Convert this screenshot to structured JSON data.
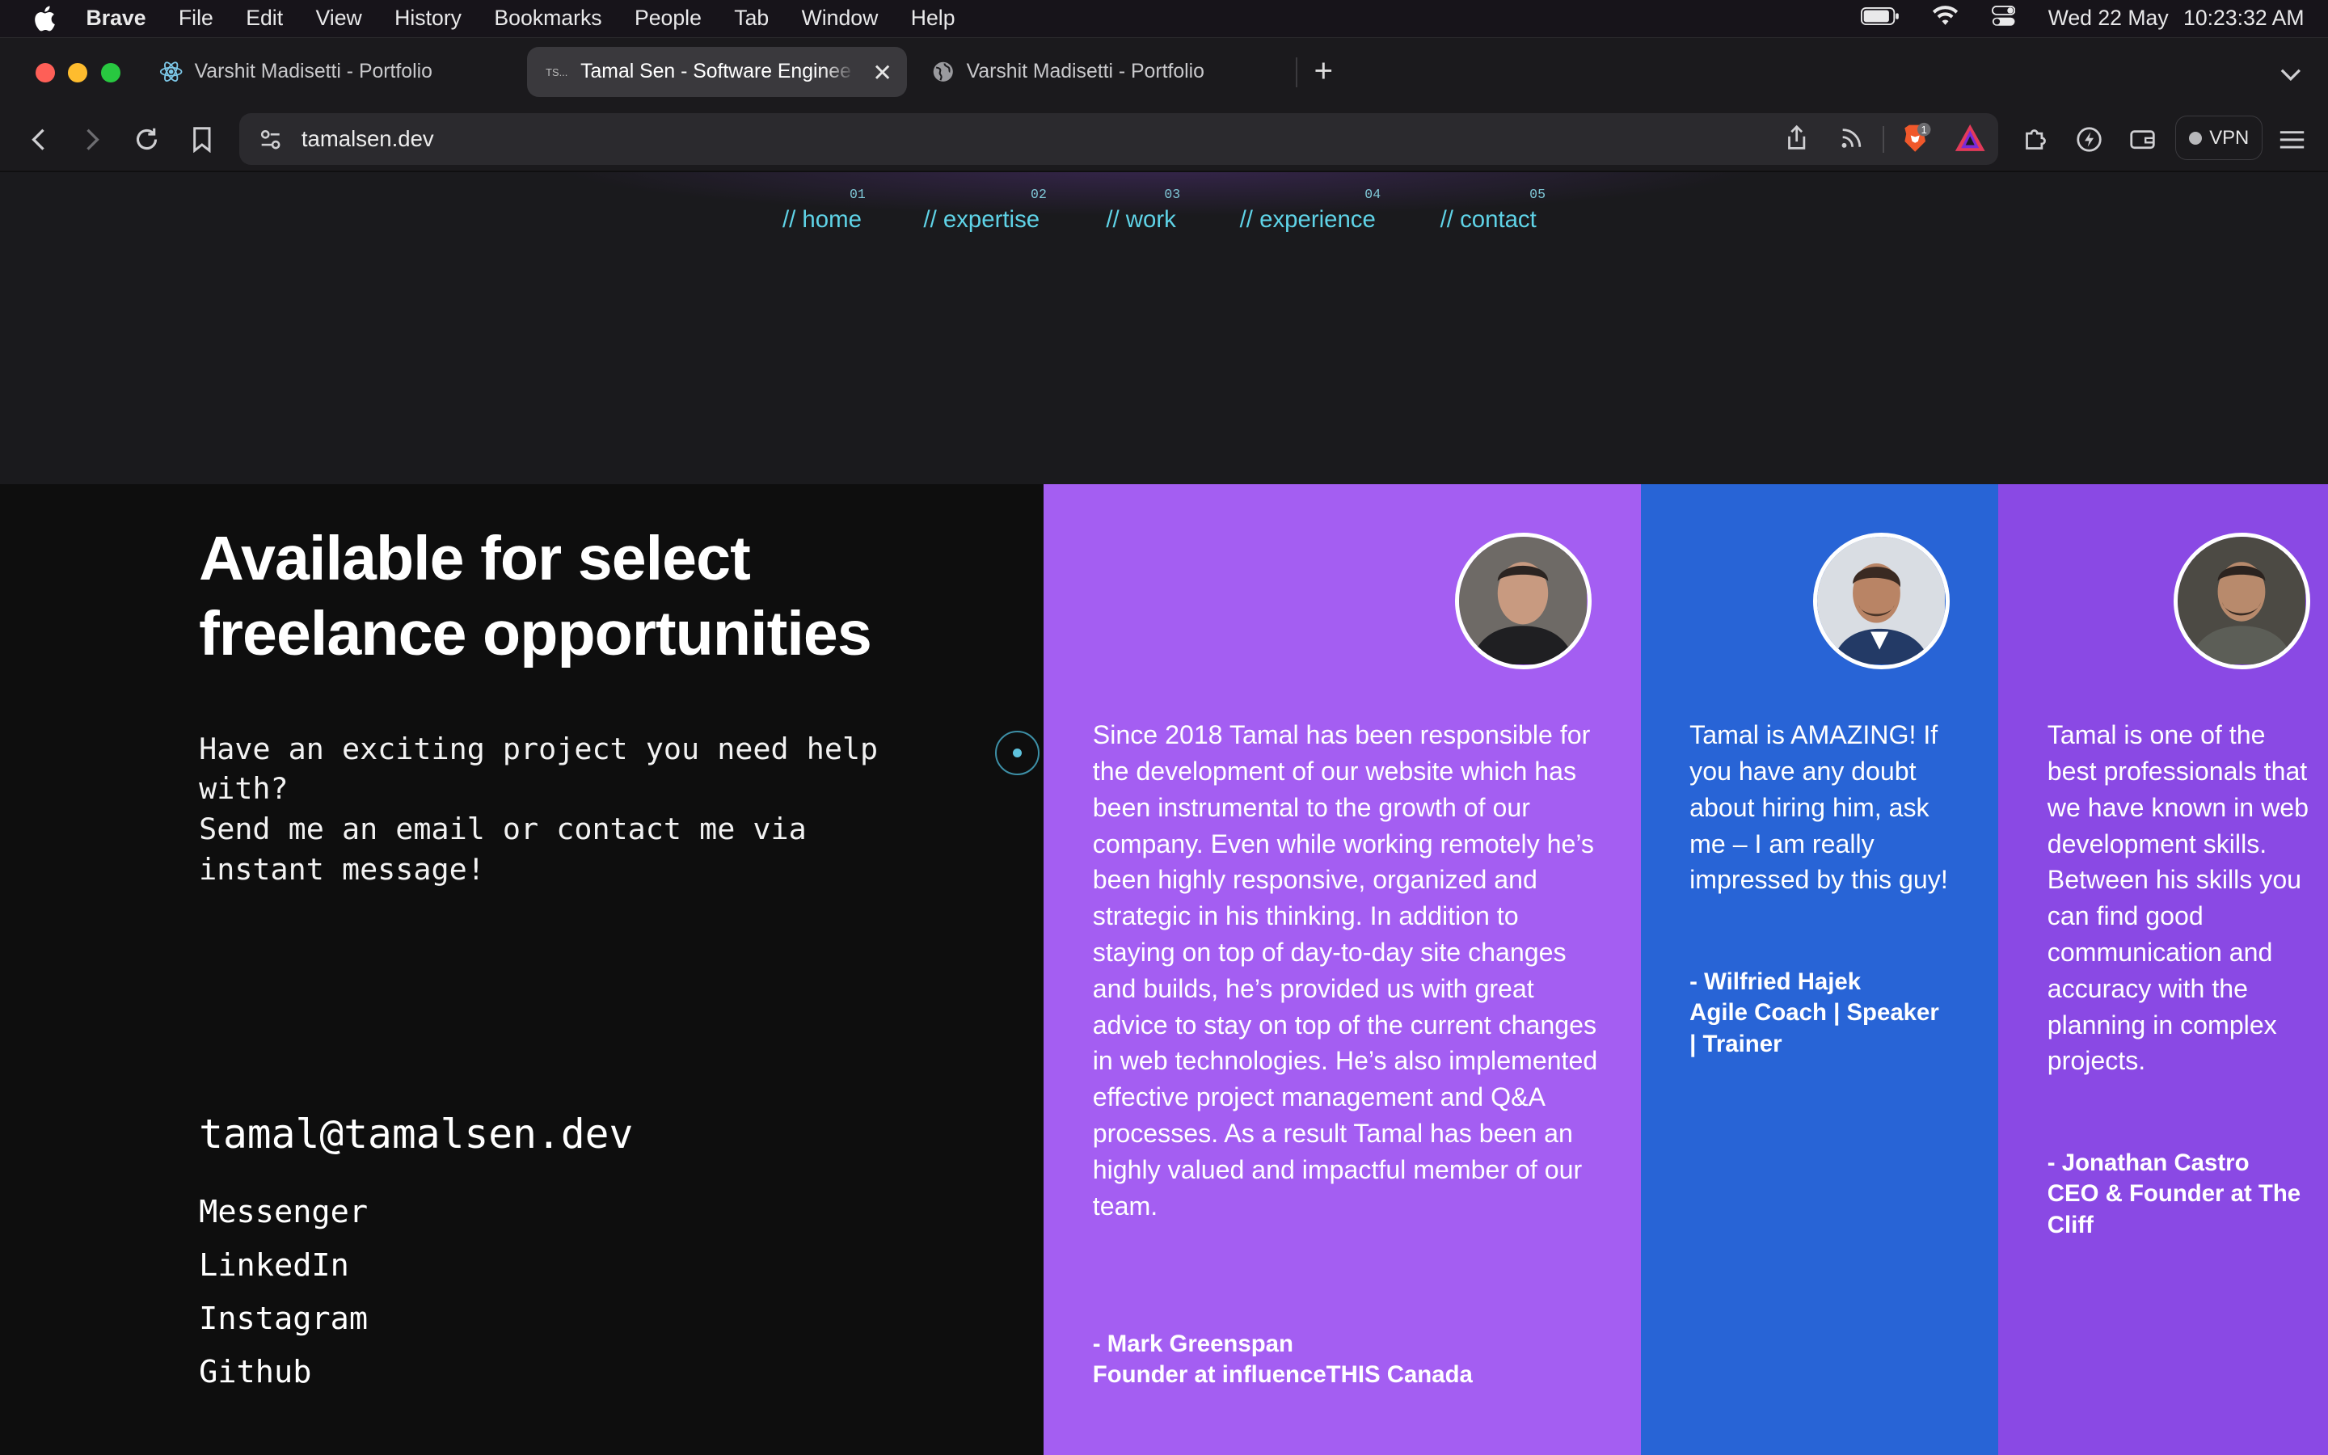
{
  "menubar": {
    "app": "Brave",
    "items": [
      "File",
      "Edit",
      "View",
      "History",
      "Bookmarks",
      "People",
      "Tab",
      "Window",
      "Help"
    ],
    "date": "Wed 22 May",
    "time": "10:23:32 AM"
  },
  "tabs": [
    {
      "title": "Varshit Madisetti - Portfolio",
      "icon": "react-icon"
    },
    {
      "title": "Tamal Sen - Software Enginee",
      "icon": "ts-favicon",
      "favicon_text": "TS...",
      "active": true
    },
    {
      "title": "Varshit Madisetti - Portfolio",
      "icon": "globe-icon"
    }
  ],
  "toolbar": {
    "url": "tamalsen.dev",
    "shields_count": "1",
    "vpn_label": "VPN"
  },
  "nav": [
    {
      "num": "01",
      "label": "// home"
    },
    {
      "num": "02",
      "label": "// expertise"
    },
    {
      "num": "03",
      "label": "// work"
    },
    {
      "num": "04",
      "label": "// experience"
    },
    {
      "num": "05",
      "label": "// contact"
    }
  ],
  "contact": {
    "heading": "Available for select freelance opportunities",
    "pitch_line1": "Have an exciting project you need help with?",
    "pitch_line2": "Send me an email or contact me via instant message!",
    "email": "tamal@tamalsen.dev",
    "links": [
      "Messenger",
      "LinkedIn",
      "Instagram",
      "Github"
    ]
  },
  "testimonials": [
    {
      "quote": "Since 2018 Tamal has been responsible for the development of our website which has been instrumental to the growth of our company. Even while working remotely he’s been highly responsive, organized and strategic in his thinking. In addition to staying on top of day-to-day site changes and builds, he’s provided us with great advice to stay on top of the current changes in web technologies. He’s also implemented effective project management and Q&A processes. As a result Tamal has been an highly valued and impactful member of our team.",
      "author_name": "- Mark Greenspan",
      "author_title": "Founder at influenceTHIS Canada",
      "color": "#a45ef2"
    },
    {
      "quote": "Tamal is AMAZING! If you have any doubt about hiring him, ask me – I am really impressed by this guy!",
      "author_name": "- Wilfried Hajek",
      "author_title": "Agile Coach | Speaker | Trainer",
      "color": "#2864d6"
    },
    {
      "quote": "Tamal is one of the best professionals that we have known in web development skills. Between his skills you can find good communication and accuracy with the planning in complex projects.",
      "author_name": "- Jonathan Castro",
      "author_title": "CEO & Founder at The Cliff",
      "color": "#8a49e4"
    }
  ]
}
